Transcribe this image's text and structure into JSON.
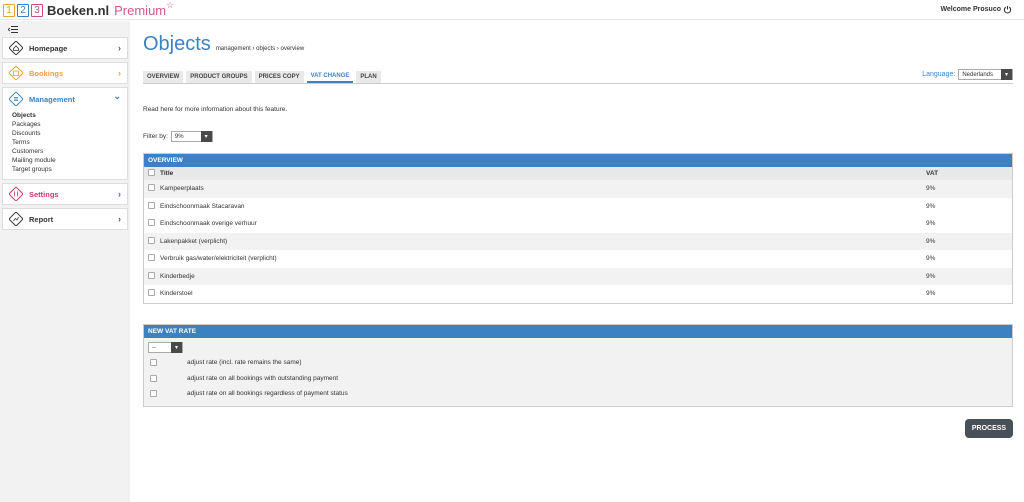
{
  "header": {
    "logo_digits": [
      "1",
      "2",
      "3"
    ],
    "brand": "Boeken.nl",
    "premium": "Premium",
    "welcome": "Welcome Prosuco"
  },
  "sidebar": {
    "items": [
      {
        "label": "Homepage",
        "icon": "home-icon",
        "color": "#333333"
      },
      {
        "label": "Bookings",
        "icon": "calendar-icon",
        "color": "#e8a23a"
      },
      {
        "label": "Management",
        "icon": "list-icon",
        "color": "#3c82c3"
      },
      {
        "label": "Settings",
        "icon": "sliders-icon",
        "color": "#d1356b"
      },
      {
        "label": "Report",
        "icon": "chart-icon",
        "color": "#333333"
      }
    ],
    "submenu": [
      "Objects",
      "Packages",
      "Discounts",
      "Terms",
      "Customers",
      "Mailing module",
      "Target groups"
    ]
  },
  "page": {
    "title": "Objects",
    "breadcrumb": "management › objects › overview"
  },
  "tabs": [
    "OVERVIEW",
    "PRODUCT GROUPS",
    "PRICES COPY",
    "VAT CHANGE",
    "PLAN"
  ],
  "language": {
    "label": "Language:",
    "value": "Nederlands"
  },
  "info_text": "Read here for more information about this feature.",
  "filter": {
    "label": "Filter by:",
    "value": "9%"
  },
  "overview": {
    "title": "OVERVIEW",
    "columns": [
      "Title",
      "VAT"
    ],
    "rows": [
      {
        "title": "Kampeerplaats",
        "vat": "9%"
      },
      {
        "title": "Eindschoonmaak Stacaravan",
        "vat": "9%"
      },
      {
        "title": "Eindschoonmaak overige verhuur",
        "vat": "9%"
      },
      {
        "title": "Lakenpakket (verplicht)",
        "vat": "9%"
      },
      {
        "title": "Verbruik gas/water/elektriciteit (verplicht)",
        "vat": "9%"
      },
      {
        "title": "Kinderbedje",
        "vat": "9%"
      },
      {
        "title": "Kinderstoel",
        "vat": "9%"
      }
    ]
  },
  "new_vat": {
    "title": "NEW VAT RATE",
    "select_value": "--",
    "options": [
      "adjust rate (incl. rate remains the same)",
      "adjust rate on all bookings with outstanding payment",
      "adjust rate on all bookings regardless of payment status"
    ]
  },
  "process_label": "PROCESS"
}
